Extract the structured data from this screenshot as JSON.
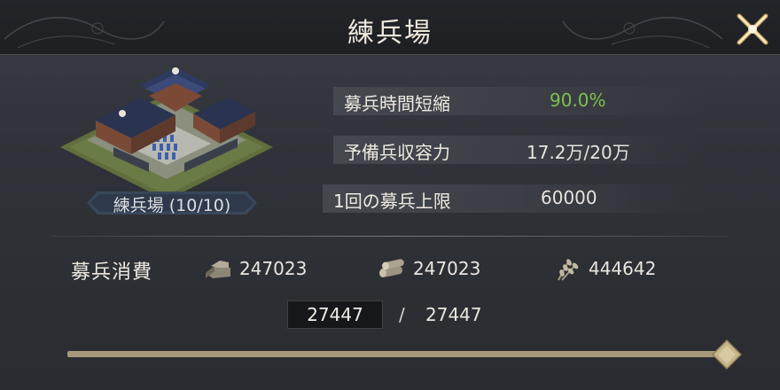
{
  "header": {
    "title": "練兵場"
  },
  "building": {
    "label": "練兵場 (10/10)"
  },
  "stats": [
    {
      "label": "募兵時間短縮",
      "value": "90.0%",
      "value_color": "#7fbf4c"
    },
    {
      "label": "予備兵収容力",
      "value": "17.2万/20万"
    },
    {
      "label": "1回の募兵上限",
      "value": "60000"
    }
  ],
  "cost": {
    "label": "募兵消費",
    "resources": [
      {
        "icon": "stone-icon",
        "amount": "247023"
      },
      {
        "icon": "wood-icon",
        "amount": "247023"
      },
      {
        "icon": "grain-icon",
        "amount": "444642"
      }
    ]
  },
  "quantity": {
    "value": "27447",
    "separator": "/",
    "max": "27447"
  },
  "slider": {
    "fraction": 1.0
  },
  "colors": {
    "accent_gold": "#a8987a",
    "positive_green": "#7fbf4c"
  }
}
